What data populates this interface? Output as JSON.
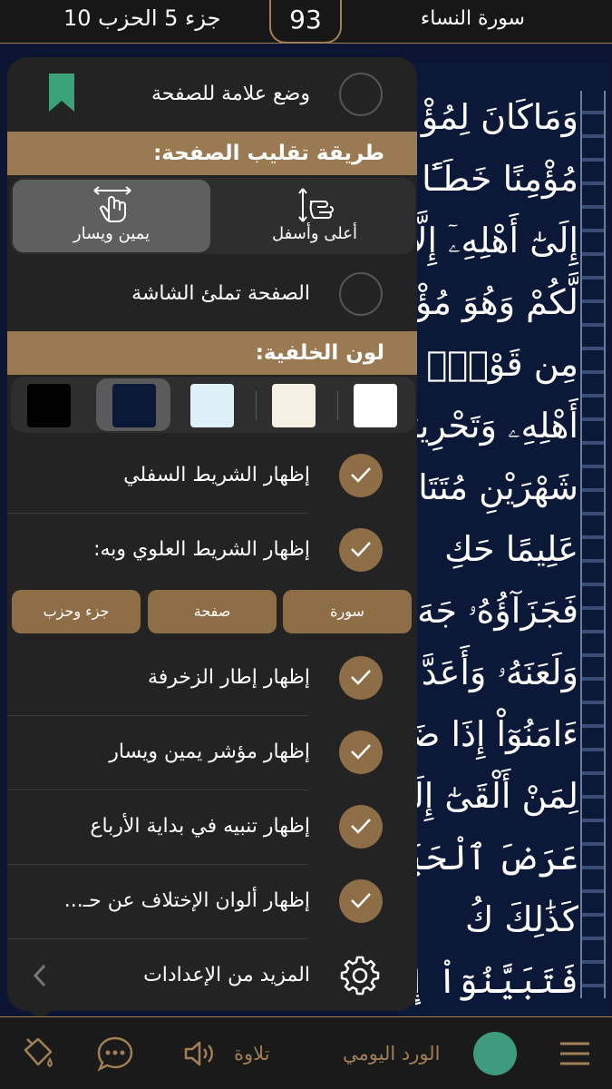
{
  "header": {
    "juz_hizb": "جزء 5 الحزب 10",
    "page_number": "93",
    "surah": "سورة النساء"
  },
  "quran_lines": [
    "وَمَاكَانَ لِمُؤْ",
    "مُؤْمِنًا خَطَـًٔا فَتَ",
    "إِلَىٰٓ أَهْلِهِۦٓ إِلَّآ",
    "لَّكُمْ وَهُوَ مُؤْ",
    "مِن قَوْمٍۭ بَيْنَكُ",
    "أَهْلِهِۦ وَتَحْرِيرُ",
    "شَهْرَيْنِ مُتَتَابِ",
    "عَلِيمًا حَكِ",
    "فَجَزَآؤُهُۥ جَهَ",
    "وَلَعَنَهُۥ وَأَعَدَّ",
    "ءَامَنُوٓاْ إِذَا ضَرَبْ",
    "لِمَنْ أَلْقَىٰٓ إِلَيْ",
    "عَرَضَ ٱلْحَيَوٰ",
    "كَذَٰلِكَ كُ",
    "فَتَبَيَّنُوٓاْ إِنَّ ٱ"
  ],
  "panel": {
    "bookmark_label": "وضع علامة للصفحة",
    "page_flip_heading": "طريقة تقليب الصفحة:",
    "flip_options": [
      {
        "label": "أعلى وأسفل",
        "selected": false
      },
      {
        "label": "يمين ويسار",
        "selected": true
      }
    ],
    "fill_screen_label": "الصفحة تملئ الشاشة",
    "background_heading": "لون الخلفية:",
    "background_colors": [
      "#000000",
      "#0b1838",
      "#dff0f8",
      "#f6efe3",
      "#ffffff"
    ],
    "selected_background": "#0b1838",
    "show_bottom_bar": "إظهار الشريط السفلي",
    "show_top_bar": "إظهار الشريط العلوي وبه:",
    "top_bar_chips": [
      "سورة",
      "صفحة",
      "جزء وحزب"
    ],
    "show_frame": "إظهار إطار الزخرفة",
    "show_pointer": "إظهار مؤشر يمين ويسار",
    "show_quarter_alert": "إظهار تنبيه في بداية الأرباع",
    "show_variant_colors": "إظهار ألوان الإختلاف عن حـ...",
    "more_settings": "المزيد من الإعدادات"
  },
  "bottombar": {
    "tilawa": "تلاوة",
    "wird": "الورد اليومي"
  },
  "colors": {
    "accent": "#9a7a52",
    "check": "#8e6e47",
    "bookmark": "#3aa37a",
    "wird_dot": "#3f9b7d"
  }
}
